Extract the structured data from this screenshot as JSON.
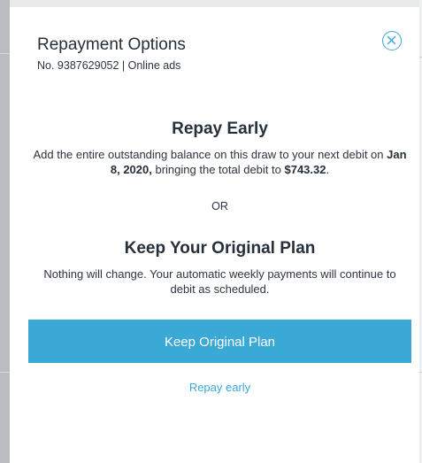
{
  "modal": {
    "title": "Repayment Options",
    "subtitle": "No. 9387629052 | Online ads",
    "close_icon": "close-circle-icon"
  },
  "repay_early": {
    "title": "Repay Early",
    "desc_prefix": "Add the entire outstanding balance on this draw to your next debit on ",
    "date": "Jan 8, 2020,",
    "desc_middle": " bringing the total debit to ",
    "amount": "$743.32",
    "desc_suffix": "."
  },
  "separator": {
    "text": "OR"
  },
  "keep_plan": {
    "title": "Keep Your Original Plan",
    "desc": "Nothing will change. Your automatic weekly payments will continue to debit as scheduled."
  },
  "actions": {
    "primary_label": "Keep Original Plan",
    "secondary_label": "Repay early"
  },
  "colors": {
    "accent": "#3aa9d6",
    "text": "#2b3440",
    "sidebar_gray": "#b9bcc0"
  }
}
